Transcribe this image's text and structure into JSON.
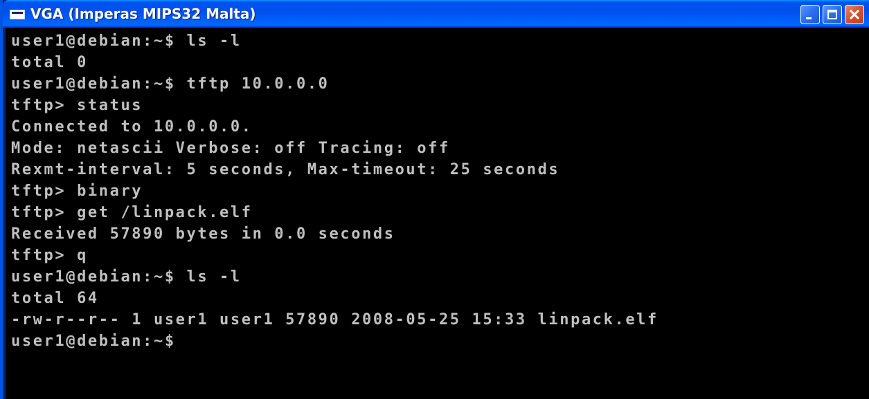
{
  "window": {
    "title": "VGA (Imperas MIPS32 Malta)",
    "icon": "terminal-window-icon",
    "controls": {
      "minimize_icon": "minimize-icon",
      "maximize_icon": "maximize-icon",
      "close_icon": "close-icon"
    }
  },
  "colors": {
    "titlebar": "#0054e3",
    "terminal_bg": "#000000",
    "terminal_fg": "#c0c0c0",
    "close_button": "#d5502c"
  },
  "terminal": {
    "lines": [
      "user1@debian:~$ ls -l",
      "total 0",
      "user1@debian:~$ tftp 10.0.0.0",
      "tftp> status",
      "Connected to 10.0.0.0.",
      "Mode: netascii Verbose: off Tracing: off",
      "Rexmt-interval: 5 seconds, Max-timeout: 25 seconds",
      "tftp> binary",
      "tftp> get /linpack.elf",
      "Received 57890 bytes in 0.0 seconds",
      "tftp> q",
      "user1@debian:~$ ls -l",
      "total 64",
      "-rw-r--r-- 1 user1 user1 57890 2008-05-25 15:33 linpack.elf",
      "user1@debian:~$"
    ]
  }
}
